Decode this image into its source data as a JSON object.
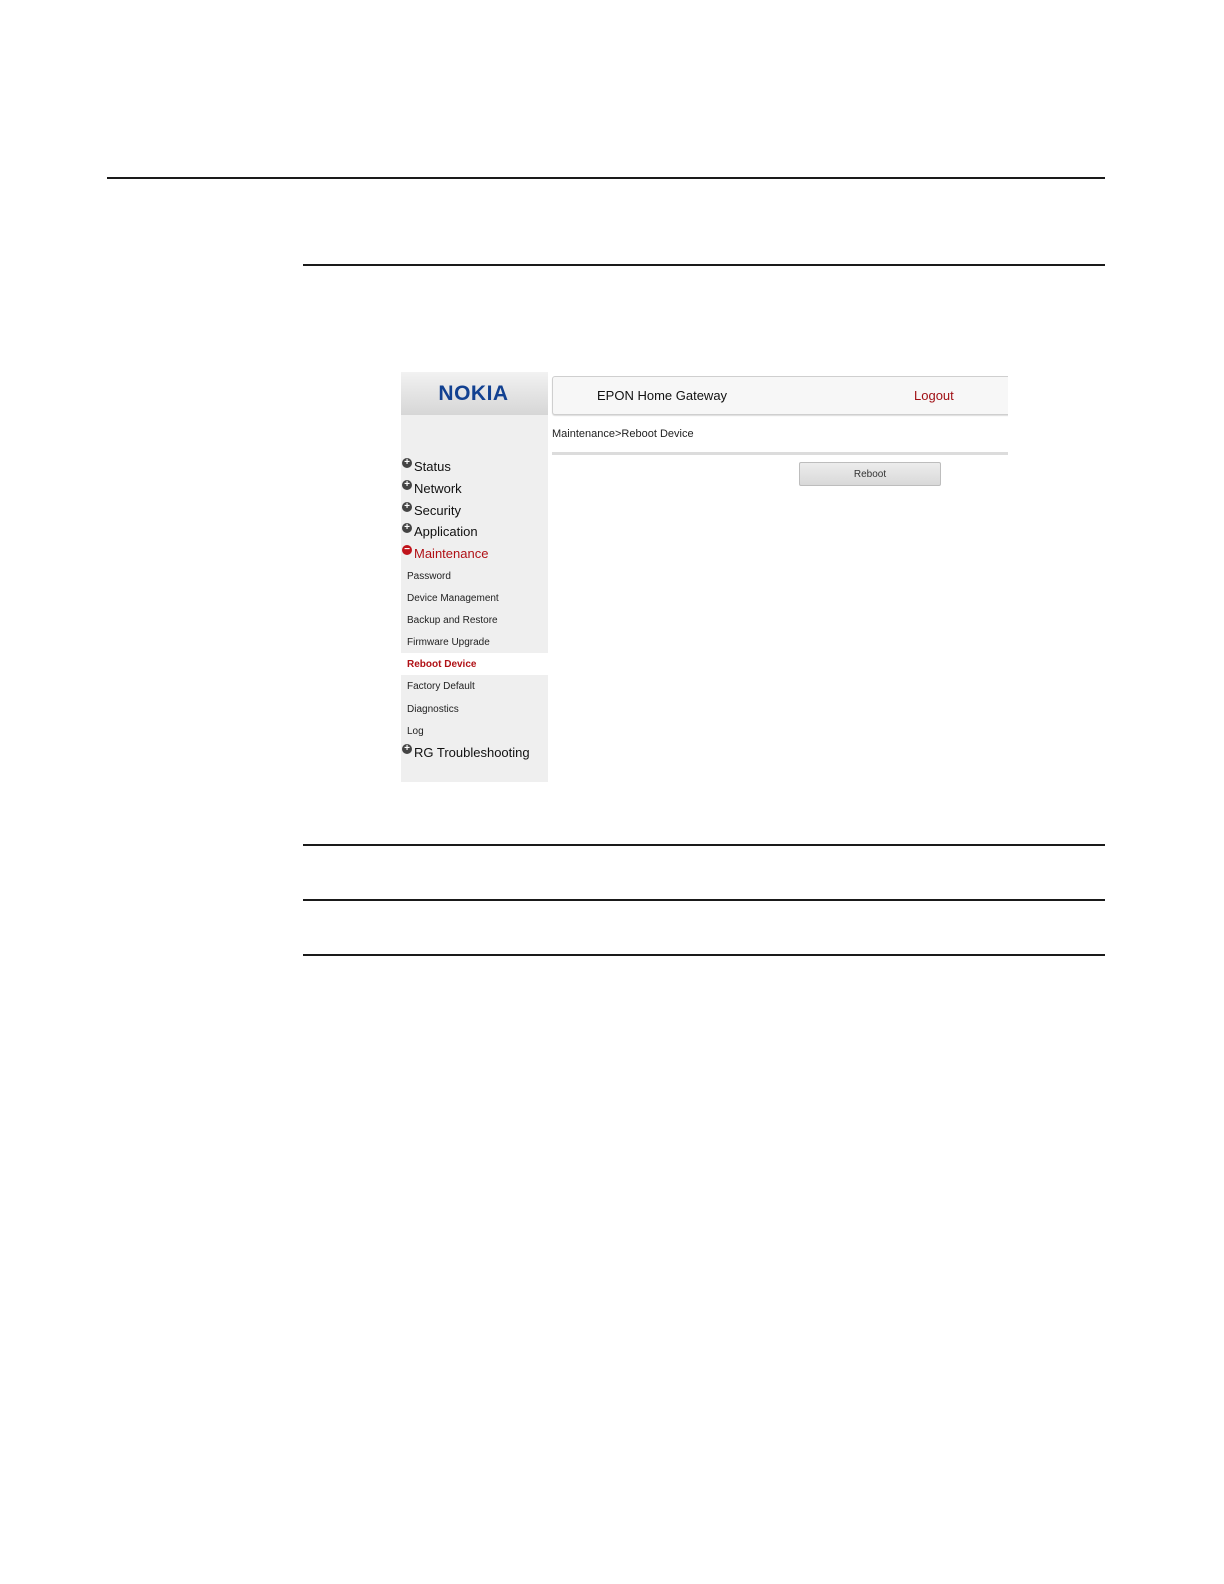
{
  "app": {
    "logo_text": "NOKIA",
    "title": "EPON Home Gateway",
    "logout_label": "Logout"
  },
  "breadcrumb": "Maintenance>Reboot Device",
  "sidebar": {
    "items": [
      {
        "label": "Status",
        "expanded": false,
        "symbol": "+"
      },
      {
        "label": "Network",
        "expanded": false,
        "symbol": "+"
      },
      {
        "label": "Security",
        "expanded": false,
        "symbol": "+"
      },
      {
        "label": "Application",
        "expanded": false,
        "symbol": "+"
      },
      {
        "label": "Maintenance",
        "expanded": true,
        "symbol": "−"
      },
      {
        "label": "RG Troubleshooting",
        "expanded": false,
        "symbol": "+"
      }
    ],
    "sub_items": [
      {
        "label": "Password"
      },
      {
        "label": "Device Management"
      },
      {
        "label": "Backup and Restore"
      },
      {
        "label": "Firmware Upgrade"
      },
      {
        "label": "Reboot Device",
        "selected": true
      },
      {
        "label": "Factory Default"
      },
      {
        "label": "Diagnostics"
      },
      {
        "label": "Log"
      }
    ]
  },
  "main": {
    "reboot_button_label": "Reboot"
  },
  "colors": {
    "brand": "#124191",
    "accent": "#b01116",
    "sidebar_bg": "#efefef"
  }
}
